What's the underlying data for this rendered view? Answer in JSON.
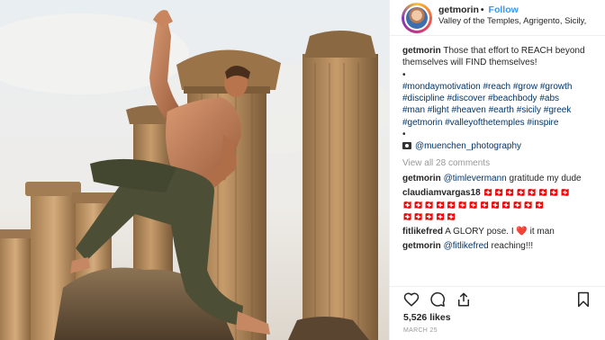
{
  "header": {
    "username": "getmorin",
    "separator": "•",
    "follow_label": "Follow",
    "location": "Valley of the Temples, Agrigento, Sicily,"
  },
  "caption": {
    "username": "getmorin",
    "text": "Those that effort to REACH beyond themselves will FIND themselves!",
    "bullet1": "•",
    "hashtags_line1": "#mondaymotivation #reach #grow #growth",
    "hashtags_line2": "#discipline #discover #beachbody #abs",
    "hashtags_line3": "#man #light #heaven #earth #sicily #greek",
    "hashtags_line4": "#getmorin #valleyofthetemples #inspire",
    "bullet2": "•",
    "photo_credit": "@muenchen_photography"
  },
  "view_all_label": "View all 28 comments",
  "comments": [
    {
      "username": "getmorin",
      "mention": "@timlevermann",
      "text": " gratitude my dude"
    },
    {
      "username": "claudiamvargas18",
      "flags_line1": "🇨🇭🇨🇭🇨🇭🇨🇭🇨🇭🇨🇭🇨🇭🇨🇭",
      "flags_line2": "🇨🇭🇨🇭🇨🇭🇨🇭🇨🇭🇨🇭🇨🇭🇨🇭🇨🇭🇨🇭🇨🇭🇨🇭🇨🇭",
      "flags_line3": "🇨🇭🇨🇭🇨🇭🇨🇭🇨🇭"
    },
    {
      "username": "fitlikefred",
      "text_before": "A GLORY pose. I ",
      "heart": "❤️",
      "text_after": " it man"
    },
    {
      "username": "getmorin",
      "mention": "@fitlikefred",
      "text": " reaching!!!"
    }
  ],
  "likes": "5,526 likes",
  "date": "MARCH 25",
  "icons": [
    "heart-icon",
    "comment-icon",
    "share-icon",
    "bookmark-icon",
    "camera-icon"
  ],
  "colors": {
    "link": "#003569",
    "follow": "#3897f0",
    "muted": "#999999",
    "text": "#262626"
  }
}
